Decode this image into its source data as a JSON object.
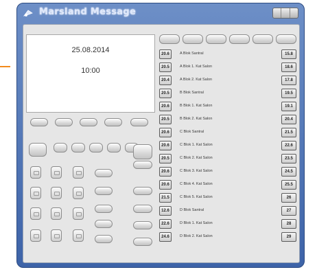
{
  "window": {
    "title": "Marsland Message"
  },
  "display": {
    "date": "25.08.2014",
    "time": "10:00"
  },
  "rows": [
    {
      "left": "20.6",
      "label": "A Blok Santral",
      "right": "15.8"
    },
    {
      "left": "20.5",
      "label": "A Blok 1. Kat Salon",
      "right": "18.6"
    },
    {
      "left": "20.4",
      "label": "A Blok 2. Kat Salon",
      "right": "17.8"
    },
    {
      "left": "20.5",
      "label": "B Blok Santral",
      "right": "19.5"
    },
    {
      "left": "20.6",
      "label": "B Blok 1. Kat Salon",
      "right": "19.1"
    },
    {
      "left": "20.5",
      "label": "B Blok 2. Kat Salon",
      "right": "20.4"
    },
    {
      "left": "20.6",
      "label": "C Blok Santral",
      "right": "21.5"
    },
    {
      "left": "20.6",
      "label": "C Blok 1. Kat Salon",
      "right": "22.6"
    },
    {
      "left": "20.5",
      "label": "C Blok 2. Kat Salon",
      "right": "23.5"
    },
    {
      "left": "20.6",
      "label": "C Blok 3. Kat Salon",
      "right": "24.5"
    },
    {
      "left": "20.6",
      "label": "C Blok 4. Kat Salon",
      "right": "25.5"
    },
    {
      "left": "21.5",
      "label": "C Blok 5. Kat Salon",
      "right": "26"
    },
    {
      "left": "12.6",
      "label": "D Blok Santral",
      "right": "27"
    },
    {
      "left": "22.6",
      "label": "D Blok 1. Kat Salon",
      "right": "28"
    },
    {
      "left": "24.6",
      "label": "D Blok 2. Kat Salon",
      "right": "29"
    }
  ]
}
